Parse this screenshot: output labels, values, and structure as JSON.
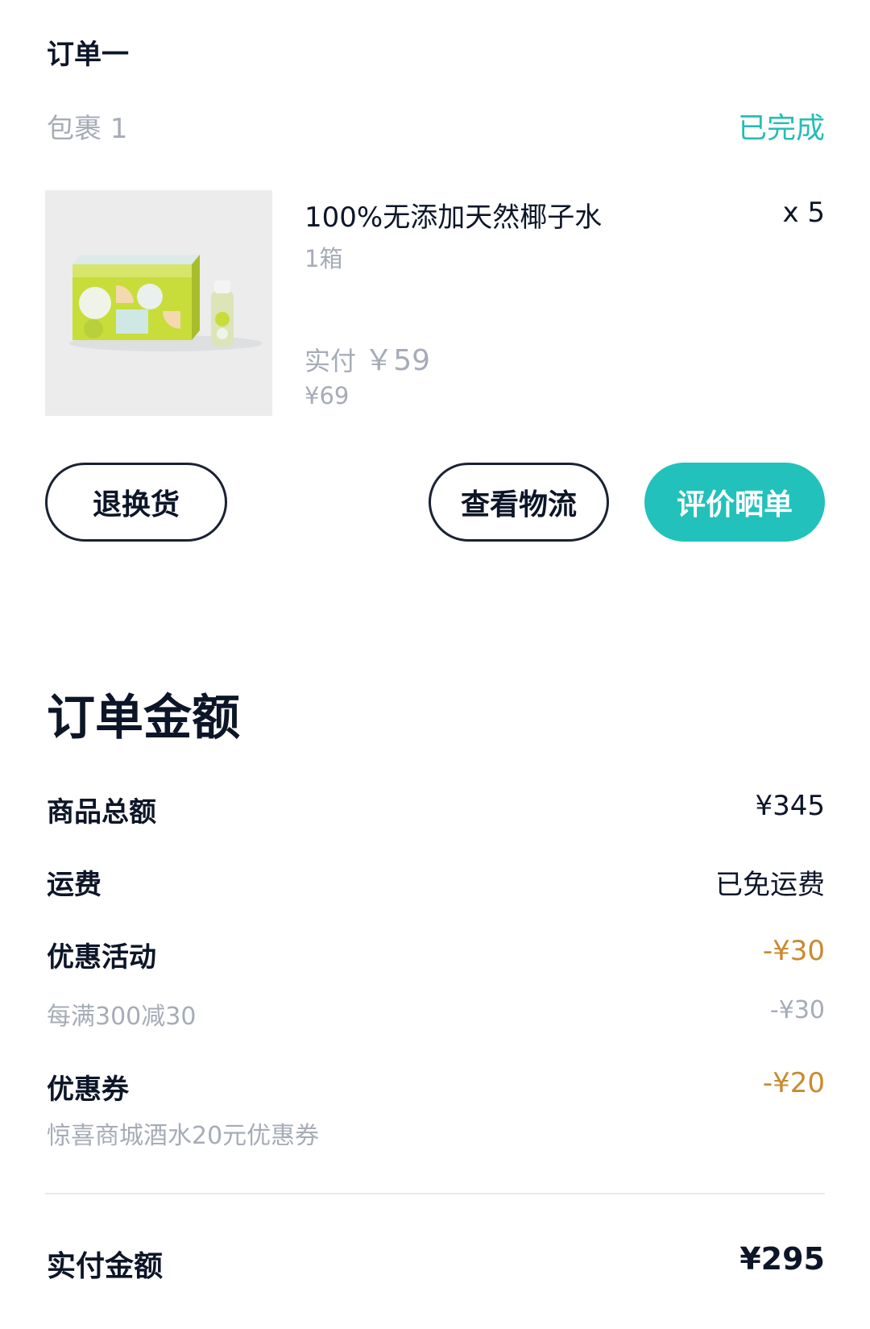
{
  "order": {
    "title": "订单一",
    "package_label": "包裹 1",
    "status": "已完成"
  },
  "product": {
    "name": "100%无添加天然椰子水",
    "quantity": "x 5",
    "spec": "1箱",
    "paid_label": "实付",
    "paid_amount": "￥59",
    "original_price": "¥69",
    "image_icon": "coconut-water-product-image"
  },
  "actions": {
    "return_label": "退换货",
    "track_label": "查看物流",
    "review_label": "评价晒单"
  },
  "summary": {
    "title": "订单金额",
    "goods_total_label": "商品总额",
    "goods_total_value": "¥345",
    "shipping_label": "运费",
    "shipping_value": "已免运费",
    "promo_label": "优惠活动",
    "promo_value": "-¥30",
    "promo_detail_label": "每满300减30",
    "promo_detail_value": "-¥30",
    "coupon_label": "优惠券",
    "coupon_value": "-¥20",
    "coupon_detail_label": "惊喜商城酒水20元优惠券",
    "paid_total_label": "实付金额",
    "paid_total_value": "¥295"
  },
  "colors": {
    "accent": "#22c1bb",
    "status": "#27bdb6",
    "discount": "#c98a2e",
    "muted": "#a6acb7",
    "text": "#0d1628"
  }
}
